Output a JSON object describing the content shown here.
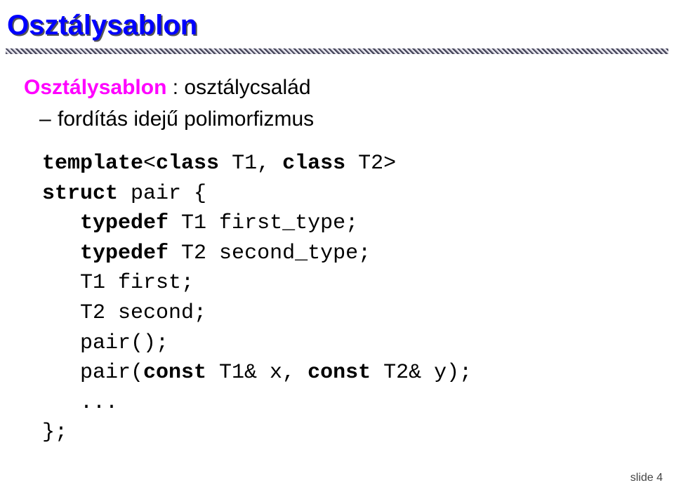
{
  "title": "Osztálysablon",
  "intro": {
    "term": "Osztálysablon",
    "rest": " : osztálycsalád",
    "bullet": "fordítás idejű polimorfizmus"
  },
  "code": {
    "kw_template": "template",
    "kw_class1": "class",
    "t1": " T1, ",
    "kw_class2": "class",
    "t2": " T2>",
    "kw_struct": "struct",
    "struct_rest": " pair {",
    "ind": "   ",
    "kw_typedef1": "typedef",
    "td1_rest": " T1 first_type;",
    "kw_typedef2": "typedef",
    "td2_rest": " T2 second_type;",
    "m1": "   T1 first;",
    "m2": "   T2 second;",
    "ctor0": "   pair();",
    "ctor1_a": "   pair(",
    "kw_const1": "const",
    "ctor1_b": " T1& x, ",
    "kw_const2": "const",
    "ctor1_c": " T2& y);",
    "dots": "   ...",
    "close": "};"
  },
  "footer": "slide 4"
}
